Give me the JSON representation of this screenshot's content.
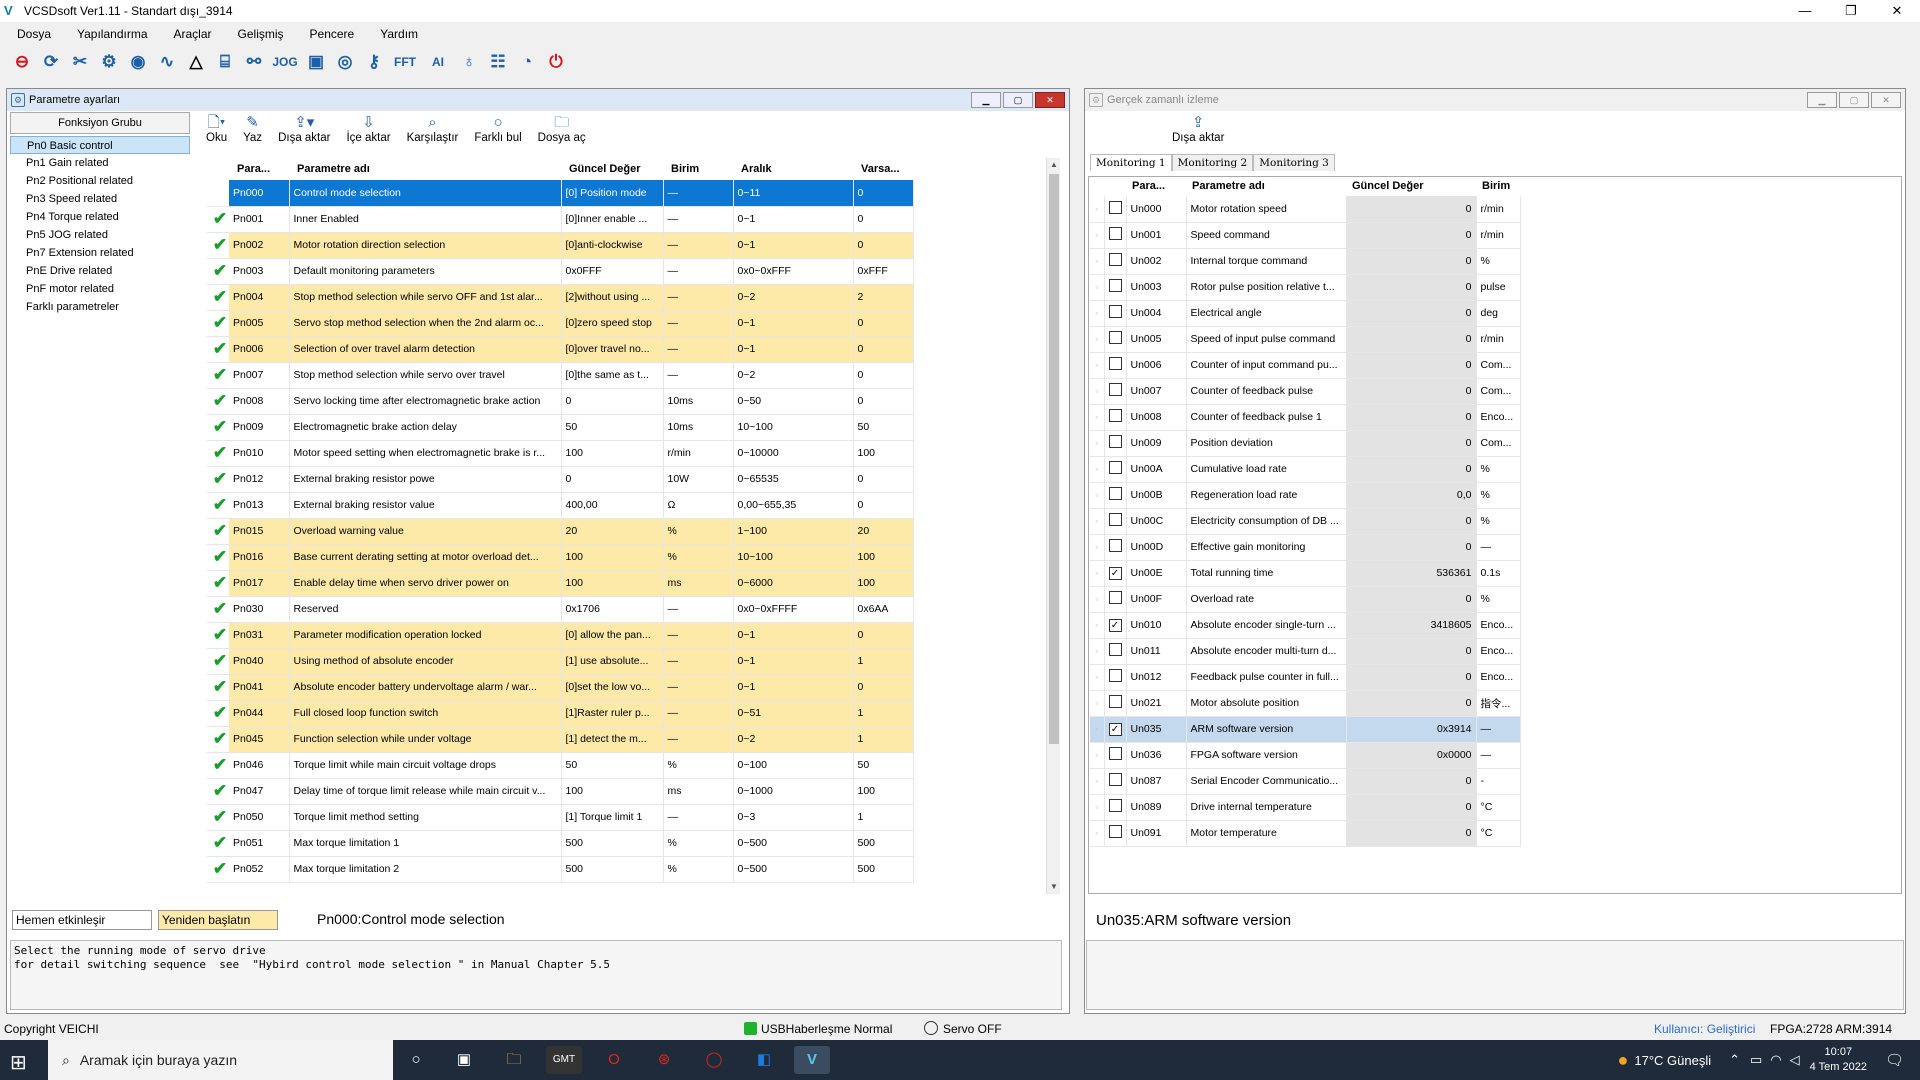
{
  "window": {
    "title": "VCSDsoft Ver1.11 - Standart dışı_3914",
    "logo": "V"
  },
  "menu": [
    "Dosya",
    "Yapılandırma",
    "Araçlar",
    "Gelişmiş",
    "Pencere",
    "Yardım"
  ],
  "toolbar_icons": [
    {
      "name": "disconnect-icon",
      "glyph": "⊖",
      "color": "red"
    },
    {
      "name": "refresh-icon",
      "glyph": "⟳"
    },
    {
      "name": "tools-icon",
      "glyph": "✂"
    },
    {
      "name": "gear-icon",
      "glyph": "⚙"
    },
    {
      "name": "eye-icon",
      "glyph": "◉"
    },
    {
      "name": "waveform-icon",
      "glyph": "∿"
    },
    {
      "name": "warning-triangle-icon",
      "glyph": "△",
      "color": "black"
    },
    {
      "name": "io-icon",
      "glyph": "⌸"
    },
    {
      "name": "tuning-icon",
      "glyph": "⚯"
    },
    {
      "name": "jog-text-icon",
      "glyph": "JOG",
      "text": true
    },
    {
      "name": "jog-box-icon",
      "glyph": "▣"
    },
    {
      "name": "target-icon",
      "glyph": "◎"
    },
    {
      "name": "key-icon",
      "glyph": "⚷"
    },
    {
      "name": "fft-icon",
      "glyph": "FFT",
      "text": true
    },
    {
      "name": "ai-icon",
      "glyph": "AI",
      "text": true
    },
    {
      "name": "bulb-icon",
      "glyph": "♁"
    },
    {
      "name": "sliders-icon",
      "glyph": "☷"
    },
    {
      "name": "gauge-icon",
      "glyph": "◔"
    },
    {
      "name": "power-icon",
      "glyph": "⏻",
      "color": "red"
    }
  ],
  "param_panel": {
    "title": "Parametre ayarları",
    "func_group_header": "Fonksiyon Grubu",
    "groups": [
      "Pn0 Basic control",
      "Pn1 Gain related",
      "Pn2 Positional related",
      "Pn3 Speed related",
      "Pn4 Torque related",
      "Pn5 JOG related",
      "Pn7 Extension related",
      "PnE Drive related",
      "PnF motor related",
      "Farklı parametreler"
    ],
    "buttons": {
      "read": "Oku",
      "write": "Yaz",
      "export": "Dışa aktar",
      "import": "İçe aktar",
      "compare": "Karşılaştır",
      "diff": "Farklı bul",
      "open_file": "Dosya aç"
    },
    "columns": [
      "Para...",
      "Parametre adı",
      "Güncel Değer",
      "Birim",
      "Aralık",
      "Varsa..."
    ],
    "rows": [
      {
        "id": "Pn000",
        "name": "Control mode selection",
        "value": "[0] Position mode",
        "unit": "—",
        "range": "0~11",
        "def": "0",
        "hl": "sel"
      },
      {
        "id": "Pn001",
        "name": "Inner Enabled",
        "value": "[0]Inner enable ...",
        "unit": "—",
        "range": "0~1",
        "def": "0",
        "hl": ""
      },
      {
        "id": "Pn002",
        "name": "Motor rotation direction selection",
        "value": "[0]anti-clockwise",
        "unit": "—",
        "range": "0~1",
        "def": "0",
        "hl": "yel"
      },
      {
        "id": "Pn003",
        "name": "Default monitoring parameters",
        "value": "0x0FFF",
        "unit": "—",
        "range": "0x0~0xFFF",
        "def": "0xFFF",
        "hl": ""
      },
      {
        "id": "Pn004",
        "name": "Stop method selection while servo OFF and 1st alar...",
        "value": "[2]without using ...",
        "unit": "—",
        "range": "0~2",
        "def": "2",
        "hl": "yel"
      },
      {
        "id": "Pn005",
        "name": "Servo stop method selection when the 2nd alarm oc...",
        "value": "[0]zero speed stop",
        "unit": "—",
        "range": "0~1",
        "def": "0",
        "hl": "yel"
      },
      {
        "id": "Pn006",
        "name": "Selection of over travel alarm detection",
        "value": "[0]over travel no...",
        "unit": "—",
        "range": "0~1",
        "def": "0",
        "hl": "yel"
      },
      {
        "id": "Pn007",
        "name": "Stop method selection while servo over travel",
        "value": "[0]the same as t...",
        "unit": "—",
        "range": "0~2",
        "def": "0",
        "hl": ""
      },
      {
        "id": "Pn008",
        "name": "Servo locking time after electromagnetic brake action",
        "value": "0",
        "unit": "10ms",
        "range": "0~50",
        "def": "0",
        "hl": ""
      },
      {
        "id": "Pn009",
        "name": "Electromagnetic brake action delay",
        "value": "50",
        "unit": "10ms",
        "range": "10~100",
        "def": "50",
        "hl": ""
      },
      {
        "id": "Pn010",
        "name": "Motor speed setting when electromagnetic brake is r...",
        "value": "100",
        "unit": "r/min",
        "range": "0~10000",
        "def": "100",
        "hl": ""
      },
      {
        "id": "Pn012",
        "name": "External braking resistor powe",
        "value": "0",
        "unit": "10W",
        "range": "0~65535",
        "def": "0",
        "hl": ""
      },
      {
        "id": "Pn013",
        "name": "External braking resistor value",
        "value": "400,00",
        "unit": "Ω",
        "range": "0,00~655,35",
        "def": "0",
        "hl": ""
      },
      {
        "id": "Pn015",
        "name": "Overload warning value",
        "value": "20",
        "unit": "%",
        "range": "1~100",
        "def": "20",
        "hl": "yel"
      },
      {
        "id": "Pn016",
        "name": "Base current derating setting at motor overload det...",
        "value": "100",
        "unit": "%",
        "range": "10~100",
        "def": "100",
        "hl": "yel"
      },
      {
        "id": "Pn017",
        "name": "Enable delay time when servo driver power on",
        "value": "100",
        "unit": "ms",
        "range": "0~6000",
        "def": "100",
        "hl": "yel"
      },
      {
        "id": "Pn030",
        "name": "Reserved",
        "value": "0x1706",
        "unit": "—",
        "range": "0x0~0xFFFF",
        "def": "0x6AA",
        "hl": ""
      },
      {
        "id": "Pn031",
        "name": "Parameter modification operation locked",
        "value": "[0] allow the pan...",
        "unit": "—",
        "range": "0~1",
        "def": "0",
        "hl": "yel"
      },
      {
        "id": "Pn040",
        "name": "Using method of absolute encoder",
        "value": "[1]  use absolute...",
        "unit": "—",
        "range": "0~1",
        "def": "1",
        "hl": "yel"
      },
      {
        "id": "Pn041",
        "name": "Absolute encoder battery undervoltage alarm / war...",
        "value": "[0]set the low vo...",
        "unit": "—",
        "range": "0~1",
        "def": "0",
        "hl": "yel"
      },
      {
        "id": "Pn044",
        "name": "Full closed loop function switch",
        "value": "[1]Raster ruler p...",
        "unit": "—",
        "range": "0~51",
        "def": "1",
        "hl": "yel"
      },
      {
        "id": "Pn045",
        "name": "Function selection while under voltage",
        "value": "[1] detect the m...",
        "unit": "—",
        "range": "0~2",
        "def": "1",
        "hl": "yel"
      },
      {
        "id": "Pn046",
        "name": "Torque limit while main circuit voltage drops",
        "value": "50",
        "unit": "%",
        "range": "0~100",
        "def": "50",
        "hl": ""
      },
      {
        "id": "Pn047",
        "name": "Delay time of torque limit release while main circuit v...",
        "value": "100",
        "unit": "ms",
        "range": "0~1000",
        "def": "100",
        "hl": ""
      },
      {
        "id": "Pn050",
        "name": "Torque limit method setting",
        "value": "[1] Torque limit 1",
        "unit": "—",
        "range": "0~3",
        "def": "1",
        "hl": ""
      },
      {
        "id": "Pn051",
        "name": "Max torque limitation 1",
        "value": "500",
        "unit": "%",
        "range": "0~500",
        "def": "500",
        "hl": ""
      },
      {
        "id": "Pn052",
        "name": "Max torque limitation 2",
        "value": "500",
        "unit": "%",
        "range": "0~500",
        "def": "500",
        "hl": ""
      }
    ],
    "flag_immediate": "Hemen etkinleşir",
    "flag_restart": "Yeniden başlatın",
    "selected_caption": "Pn000:Control mode selection",
    "description": "Select the running mode of servo drive\nfor detail switching sequence  see  \"Hybird control mode selection \" in Manual Chapter 5.5"
  },
  "monitor_panel": {
    "title": "Gerçek zamanlı izleme",
    "export": "Dışa aktar",
    "tabs": [
      "Monitoring 1",
      "Monitoring 2",
      "Monitoring 3"
    ],
    "columns": [
      "Para...",
      "Parametre adı",
      "Güncel Değer",
      "Birim"
    ],
    "rows": [
      {
        "id": "Un000",
        "name": "Motor rotation speed",
        "value": "0",
        "unit": "r/min",
        "checked": false,
        "sel": false
      },
      {
        "id": "Un001",
        "name": "Speed command",
        "value": "0",
        "unit": "r/min",
        "checked": false,
        "sel": false
      },
      {
        "id": "Un002",
        "name": "Internal torque command",
        "value": "0",
        "unit": "%",
        "checked": false,
        "sel": false
      },
      {
        "id": "Un003",
        "name": "Rotor pulse position relative t...",
        "value": "0",
        "unit": "pulse",
        "checked": false,
        "sel": false
      },
      {
        "id": "Un004",
        "name": "Electrical angle",
        "value": "0",
        "unit": "deg",
        "checked": false,
        "sel": false
      },
      {
        "id": "Un005",
        "name": "Speed of input pulse command",
        "value": "0",
        "unit": "r/min",
        "checked": false,
        "sel": false
      },
      {
        "id": "Un006",
        "name": "Counter of input command pu...",
        "value": "0",
        "unit": "Com...",
        "checked": false,
        "sel": false
      },
      {
        "id": "Un007",
        "name": "Counter of feedback pulse",
        "value": "0",
        "unit": "Com...",
        "checked": false,
        "sel": false
      },
      {
        "id": "Un008",
        "name": "Counter of feedback pulse 1",
        "value": "0",
        "unit": "Enco...",
        "checked": false,
        "sel": false
      },
      {
        "id": "Un009",
        "name": "Position deviation",
        "value": "0",
        "unit": "Com...",
        "checked": false,
        "sel": false
      },
      {
        "id": "Un00A",
        "name": "Cumulative load rate",
        "value": "0",
        "unit": "%",
        "checked": false,
        "sel": false
      },
      {
        "id": "Un00B",
        "name": "Regeneration load rate",
        "value": "0,0",
        "unit": "%",
        "checked": false,
        "sel": false
      },
      {
        "id": "Un00C",
        "name": "Electricity consumption of DB ...",
        "value": "0",
        "unit": "%",
        "checked": false,
        "sel": false
      },
      {
        "id": "Un00D",
        "name": "Effective gain monitoring",
        "value": "0",
        "unit": "—",
        "checked": false,
        "sel": false
      },
      {
        "id": "Un00E",
        "name": "Total running time",
        "value": "536361",
        "unit": "0.1s",
        "checked": true,
        "sel": false
      },
      {
        "id": "Un00F",
        "name": "Overload rate",
        "value": "0",
        "unit": "%",
        "checked": false,
        "sel": false
      },
      {
        "id": "Un010",
        "name": "Absolute encoder single-turn ...",
        "value": "3418605",
        "unit": "Enco...",
        "checked": true,
        "sel": false
      },
      {
        "id": "Un011",
        "name": "Absolute encoder multi-turn d...",
        "value": "0",
        "unit": "Enco...",
        "checked": false,
        "sel": false
      },
      {
        "id": "Un012",
        "name": "Feedback pulse counter in full...",
        "value": "0",
        "unit": "Enco...",
        "checked": false,
        "sel": false
      },
      {
        "id": "Un021",
        "name": "Motor absolute position",
        "value": "0",
        "unit": "指令...",
        "checked": false,
        "sel": false
      },
      {
        "id": "Un035",
        "name": "ARM software version",
        "value": "0x3914",
        "unit": "—",
        "checked": true,
        "sel": true
      },
      {
        "id": "Un036",
        "name": "FPGA software version",
        "value": "0x0000",
        "unit": "—",
        "checked": false,
        "sel": false
      },
      {
        "id": "Un087",
        "name": "Serial Encoder Communicatio...",
        "value": "0",
        "unit": "-",
        "checked": false,
        "sel": false
      },
      {
        "id": "Un089",
        "name": "Drive internal temperature",
        "value": "0",
        "unit": "°C",
        "checked": false,
        "sel": false
      },
      {
        "id": "Un091",
        "name": "Motor temperature",
        "value": "0",
        "unit": "°C",
        "checked": false,
        "sel": false
      }
    ],
    "selected_caption": "Un035:ARM software version"
  },
  "status": {
    "copyright": "Copyright  VEICHI",
    "comm": "USBHaberleşme  Normal",
    "servo": "Servo OFF",
    "user": "Kullanıcı: Geliştirici",
    "fw": "FPGA:2728 ARM:3914",
    "comm_color": "#1fb32c",
    "user_color": "#2a6bd6"
  },
  "taskbar": {
    "search_placeholder": "Aramak için buraya yazın",
    "weather": "17°C  Güneşli",
    "time": "10:07",
    "date": "4 Tem 2022"
  }
}
